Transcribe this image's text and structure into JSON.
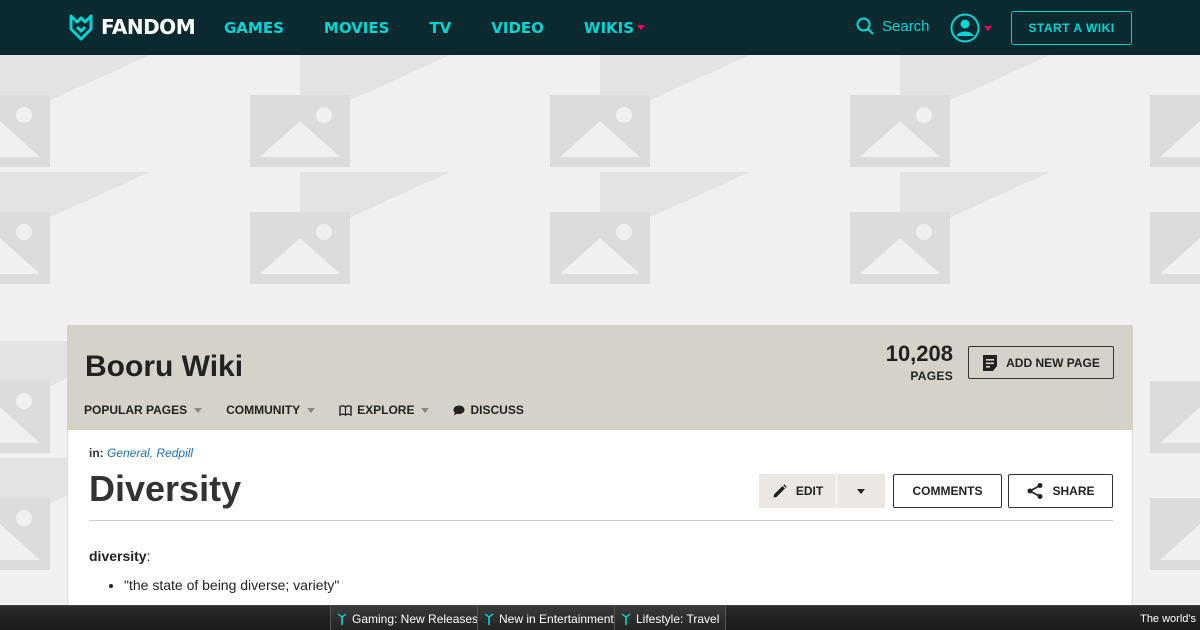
{
  "topnav": {
    "logo": "FANDOM",
    "links": [
      {
        "label": "GAMES"
      },
      {
        "label": "MOVIES"
      },
      {
        "label": "TV"
      },
      {
        "label": "VIDEO"
      },
      {
        "label": "WIKIS",
        "has_caret": true
      }
    ],
    "search_label": "Search",
    "start_wiki": "START A WIKI",
    "colors": {
      "bg": "#0b2a30",
      "accent": "#00d6d6",
      "caret": "#fa005a"
    }
  },
  "wiki": {
    "title": "Booru Wiki",
    "pages_count": "10,208",
    "pages_label": "PAGES",
    "add_page": "ADD NEW PAGE",
    "nav": {
      "popular": "POPULAR PAGES",
      "community": "COMMUNITY",
      "explore": "EXPLORE",
      "discuss": "DISCUSS"
    }
  },
  "article": {
    "cats_prefix": "in:",
    "categories": "General, Redpill",
    "title": "Diversity",
    "edit": "EDIT",
    "comments": "COMMENTS",
    "share": "SHARE",
    "term": "diversity",
    "term_suffix": ":",
    "bullets": [
      "\"the state of being diverse; variety\""
    ]
  },
  "bottom_bar": {
    "tabs": [
      "Gaming: New Releases",
      "New in Entertainment",
      "Lifestyle: Travel"
    ],
    "right_text": "The world's"
  }
}
